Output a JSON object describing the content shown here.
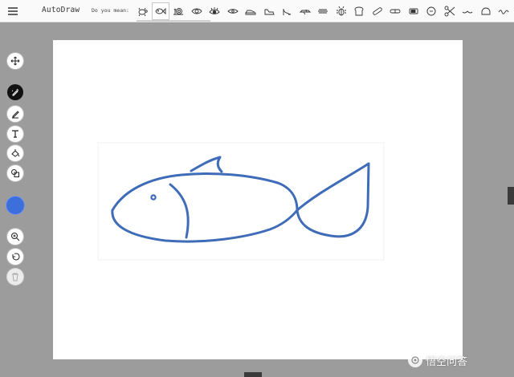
{
  "app": {
    "title": "AutoDraw"
  },
  "suggestions": {
    "label": "Do you mean:",
    "selected_index": 1,
    "items": [
      {
        "icon": "turtle-icon"
      },
      {
        "icon": "fish-icon"
      },
      {
        "icon": "snail-icon"
      },
      {
        "icon": "eye-icon"
      },
      {
        "icon": "eye-lashes-icon"
      },
      {
        "icon": "eye-outline-icon"
      },
      {
        "icon": "sneaker-icon"
      },
      {
        "icon": "shoe-icon"
      },
      {
        "icon": "high-heel-icon"
      },
      {
        "icon": "airplane-icon"
      },
      {
        "icon": "caterpillar-icon"
      },
      {
        "icon": "beetle-icon"
      },
      {
        "icon": "toast-icon"
      },
      {
        "icon": "bandage-icon"
      },
      {
        "icon": "pill-capsule-icon"
      },
      {
        "icon": "battery-icon"
      },
      {
        "icon": "coin-icon"
      },
      {
        "icon": "scissors-icon"
      },
      {
        "icon": "mustache-icon"
      },
      {
        "icon": "helmet-icon"
      },
      {
        "icon": "squiggle-icon"
      },
      {
        "icon": "wave-icon"
      }
    ]
  },
  "toolbar": {
    "tools": [
      {
        "name": "move-tool",
        "icon": "move-icon"
      },
      {
        "name": "autodraw-tool",
        "icon": "autodraw-pen-icon",
        "active": true
      },
      {
        "name": "draw-tool",
        "icon": "pencil-icon"
      },
      {
        "name": "type-tool",
        "icon": "text-icon"
      },
      {
        "name": "fill-tool",
        "icon": "paint-bucket-icon"
      },
      {
        "name": "shape-tool",
        "icon": "shapes-icon"
      },
      {
        "name": "zoom-tool",
        "icon": "zoom-icon"
      },
      {
        "name": "undo-tool",
        "icon": "undo-icon"
      },
      {
        "name": "delete-tool",
        "icon": "trash-icon",
        "disabled": true
      }
    ],
    "current_color": "#3d6fdc"
  },
  "canvas": {
    "background": "#ffffff",
    "stroke_color": "#3f6cb8"
  },
  "watermark": {
    "text": "悟空问答"
  }
}
